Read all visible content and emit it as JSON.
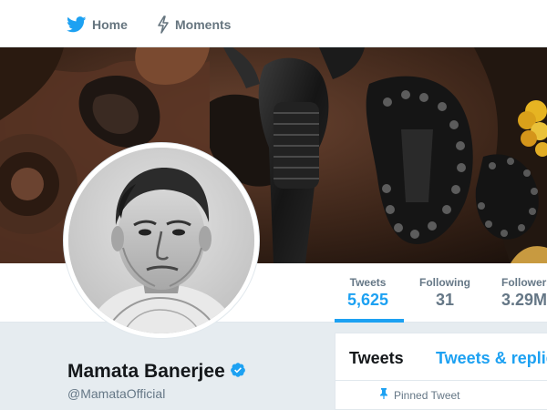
{
  "nav": {
    "items": [
      {
        "label": "Home",
        "icon": "twitter-bird-icon",
        "color": "#1da1f2"
      },
      {
        "label": "Moments",
        "icon": "lightning-bolt-icon",
        "color": "#66757f"
      }
    ]
  },
  "profile": {
    "name": "Mamata Banerjee",
    "handle": "@MamataOfficial",
    "verified": true,
    "verified_color": "#1da1f2"
  },
  "stats": [
    {
      "label": "Tweets",
      "value": "5,625",
      "active": true
    },
    {
      "label": "Following",
      "value": "31",
      "active": false
    },
    {
      "label": "Followers",
      "value": "3.29M",
      "active": false
    }
  ],
  "timeline": {
    "tabs": [
      "Tweets",
      "Tweets & replies"
    ],
    "active_tab": "Tweets",
    "pinned_label": "Pinned Tweet"
  },
  "colors": {
    "accent": "#1da1f2",
    "background": "#e6ecf0",
    "text_primary": "#14171a",
    "text_secondary": "#657786"
  }
}
